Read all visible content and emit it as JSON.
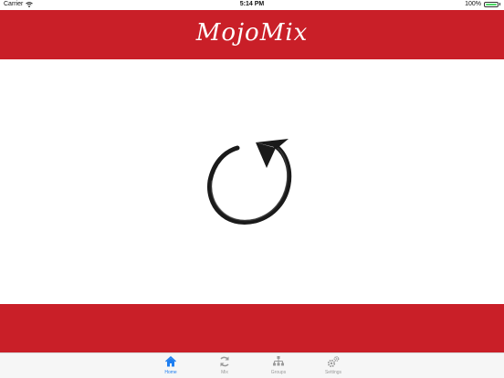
{
  "status_bar": {
    "carrier": "Carrier",
    "time": "5:14 PM",
    "battery": "100%"
  },
  "header": {
    "title": "MojoMix"
  },
  "tabs": [
    {
      "label": "Home",
      "icon": "house-icon",
      "active": true
    },
    {
      "label": "Mix",
      "icon": "refresh-icon",
      "active": false
    },
    {
      "label": "Groups",
      "icon": "hierarchy-icon",
      "active": false
    },
    {
      "label": "Settings",
      "icon": "gears-icon",
      "active": false
    }
  ],
  "colors": {
    "brand": "#c91f28",
    "active_tab": "#1e7ef0",
    "inactive_tab": "#9a9a9a"
  },
  "main": {
    "graphic": "circular-arrow-icon"
  }
}
